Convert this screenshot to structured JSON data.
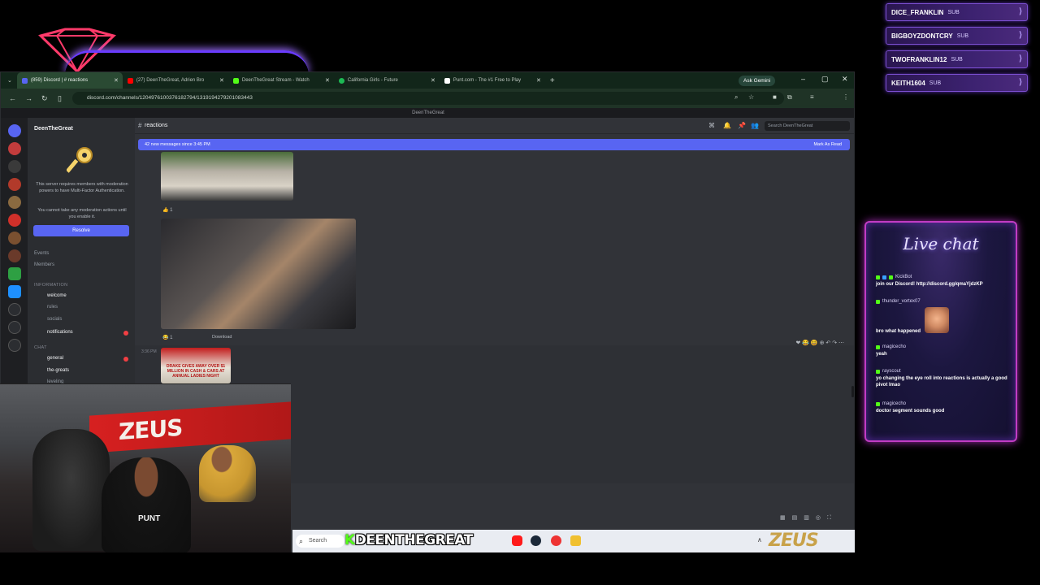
{
  "subs": [
    {
      "name": "DICE_FRANKLIN",
      "tag": "SUB"
    },
    {
      "name": "BIGBOYZDONTCRY",
      "tag": "SUB"
    },
    {
      "name": "TWOFRANKLIN12",
      "tag": "SUB"
    },
    {
      "name": "KEITH1604",
      "tag": "SUB"
    }
  ],
  "browser": {
    "tabs": [
      {
        "label": "(859) Discord | # reactions",
        "color": "#5865f2"
      },
      {
        "label": "(27) DeenTheGreat, Adrien Bro",
        "color": "#ff0000"
      },
      {
        "label": "DeenTheGreat Stream - Watch",
        "color": "#53fc18"
      },
      {
        "label": "California Girls - Future",
        "color": "#1db954"
      },
      {
        "label": "Punt.com - The #1 Free to Play",
        "color": "#ffffff"
      }
    ],
    "ask_gemini": "Ask Gemini",
    "url": "discord.com/channels/1204976100376182794/1319194279201083443",
    "top_strip": "DeenTheGreat"
  },
  "discord": {
    "guild_name": "DeenTheGreat",
    "mfa_text": "This server requires members with moderation powers to have Multi-Factor Authentication.",
    "mfa_text2": "You cannot take any moderation actions until you enable it.",
    "resolve_label": "Resolve",
    "menu": [
      "Events",
      "Members"
    ],
    "category_info": "INFORMATION",
    "info_channels": [
      "welcome",
      "rules",
      "socials",
      "notifications"
    ],
    "category_chat": "CHAT",
    "chat_channels": [
      "general",
      "the-greats",
      "leveling"
    ],
    "channel_name": "reactions",
    "search_placeholder": "Search DeenTheGreat",
    "new_messages": "42 new messages since 3:45 PM",
    "mark_read": "Mark As Read",
    "download_label": "Download",
    "react1": "👍 1",
    "react2": "😂 1",
    "timestamp": "3:36 PM",
    "news_headline": "DRAKE GIVES AWAY OVER $1 MILLION IN CASH & CARS AT ANNUAL LADIES NIGHT"
  },
  "taskbar": {
    "search_label": "Search",
    "brand_k": "K",
    "brand_name": "DEENTHEGREAT",
    "zeus": "ZEUS"
  },
  "webcam": {
    "banner": "ZEUS",
    "shirt": "PUNT"
  },
  "livechat": {
    "title": "Live chat",
    "messages": [
      {
        "user": "KickBot",
        "text": "join our Discord! http://discord.gg/qmaYjdzKP"
      },
      {
        "user": "thunder_vortex07",
        "text": "bro what happened"
      },
      {
        "user": "magicecho",
        "text": "yeah"
      },
      {
        "user": "rayscout",
        "text": "yo changing the eye roll into reactions is actually a good pivot lmao"
      },
      {
        "user": "magicecho",
        "text": "doctor segment sounds good"
      }
    ]
  },
  "colors": {
    "discord_blurple": "#5865f2",
    "kick_green": "#53fc18",
    "neon_pink": "#c23cc4"
  }
}
